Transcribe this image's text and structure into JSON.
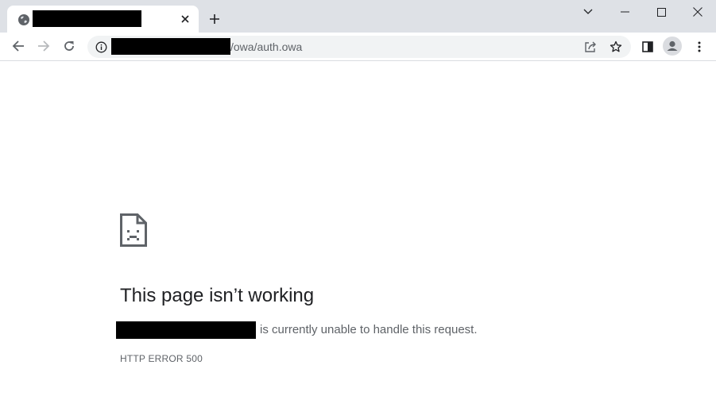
{
  "browser": {
    "tab": {
      "title": "",
      "close_glyph": "×"
    },
    "new_tab_glyph": "+",
    "window_controls": {
      "dropdown_icon": "chevron-down-icon",
      "minimize_icon": "minimize-icon",
      "maximize_icon": "maximize-icon",
      "close_icon": "close-icon"
    },
    "address_bar": {
      "url_visible": "/owa/auth.owa"
    }
  },
  "error_page": {
    "title": "This page isn’t working",
    "message": "is currently unable to handle this request.",
    "error_code": "HTTP ERROR 500"
  },
  "colors": {
    "titlebar": "#dee1e6",
    "omnibox": "#f1f3f4",
    "icon": "#5f6368",
    "title_text": "#202124"
  }
}
